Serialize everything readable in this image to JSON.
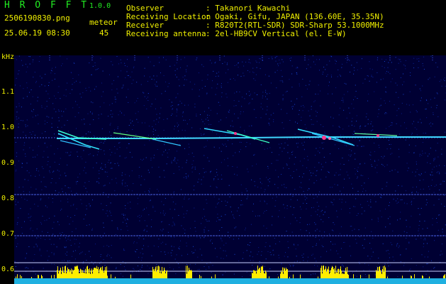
{
  "header": {
    "app_name": "H R O F F T",
    "version": "1.0.0",
    "filename": "2506190830.png",
    "datetime": "25.06.19 08:30",
    "meteor_label": "meteor",
    "meteor_count": "45"
  },
  "info": [
    {
      "label": "Observer",
      "value": ": Takanori Kawachi"
    },
    {
      "label": "Receiving Location",
      "value": ": Ogaki, Gifu, JAPAN (136.60E, 35.35N)"
    },
    {
      "label": "Receiver",
      "value": ": R820T2(RTL-SDR) SDR-Sharp 53.1000MHz"
    },
    {
      "label": "Receiving antenna",
      "value": ": 2el-HB9CV Vertical (el. E-W)"
    }
  ],
  "axis": {
    "y_unit": "kHz",
    "y_ticks": [
      "1.1",
      "1.0",
      "0.9",
      "0.8",
      "0.7",
      "0.6"
    ],
    "x_ticks": [
      "0831",
      "0832",
      "0833",
      "0834",
      "0835",
      "0836",
      "0837",
      "0838",
      "0839",
      "0840"
    ]
  },
  "colors": {
    "text": "#f0f000",
    "title": "#22ee22",
    "spectrum_bg": "#000044",
    "echo": "#30d0ff",
    "signal": "#ffee00"
  }
}
